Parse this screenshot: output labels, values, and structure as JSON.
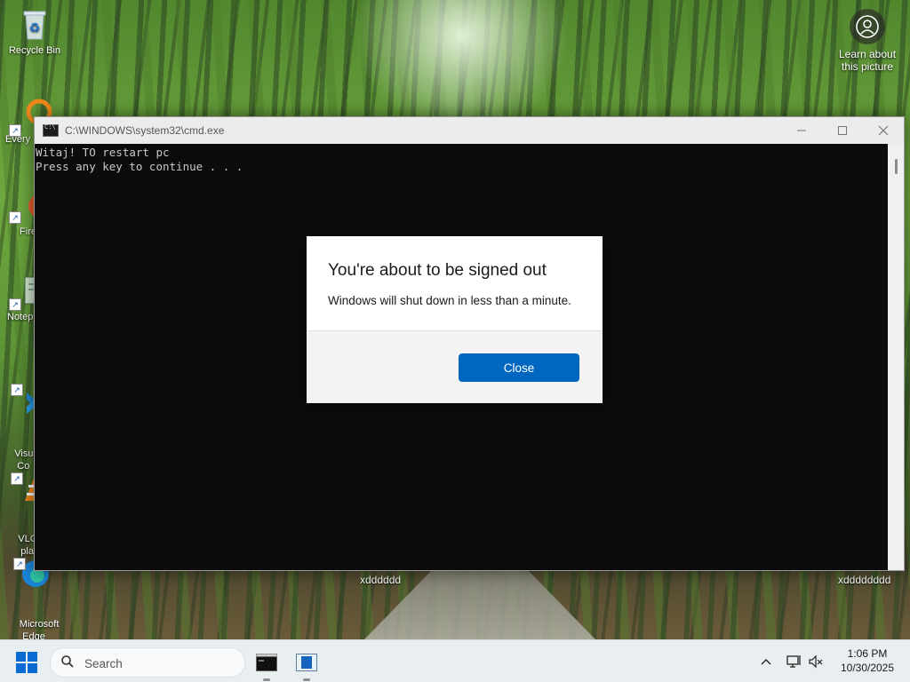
{
  "desktop": {
    "icons": [
      {
        "label": "Recycle Bin"
      },
      {
        "label": "Every"
      },
      {
        "label": "Fire"
      },
      {
        "label": "Notep"
      },
      {
        "label": "Visual\n     Co"
      },
      {
        "label": "VLC r\n     pla"
      },
      {
        "label": "Microsoft\nEdge"
      }
    ],
    "learn_picture_label": "Learn about\nthis picture",
    "wallpaper_labels": [
      "xdddddd",
      "xdddddddd"
    ]
  },
  "cmd": {
    "title": "C:\\WINDOWS\\system32\\cmd.exe",
    "lines": [
      "Witaj! TO restart pc",
      "Press any key to continue . . ."
    ]
  },
  "dialog": {
    "title": "You're about to be signed out",
    "message": "Windows will shut down in less than a minute.",
    "close_label": "Close"
  },
  "taskbar": {
    "search_placeholder": "Search",
    "clock_time": "1:06 PM",
    "clock_date": "10/30/2025"
  },
  "colors": {
    "accent": "#0067c0",
    "start_icon": "#0a6cd3"
  }
}
